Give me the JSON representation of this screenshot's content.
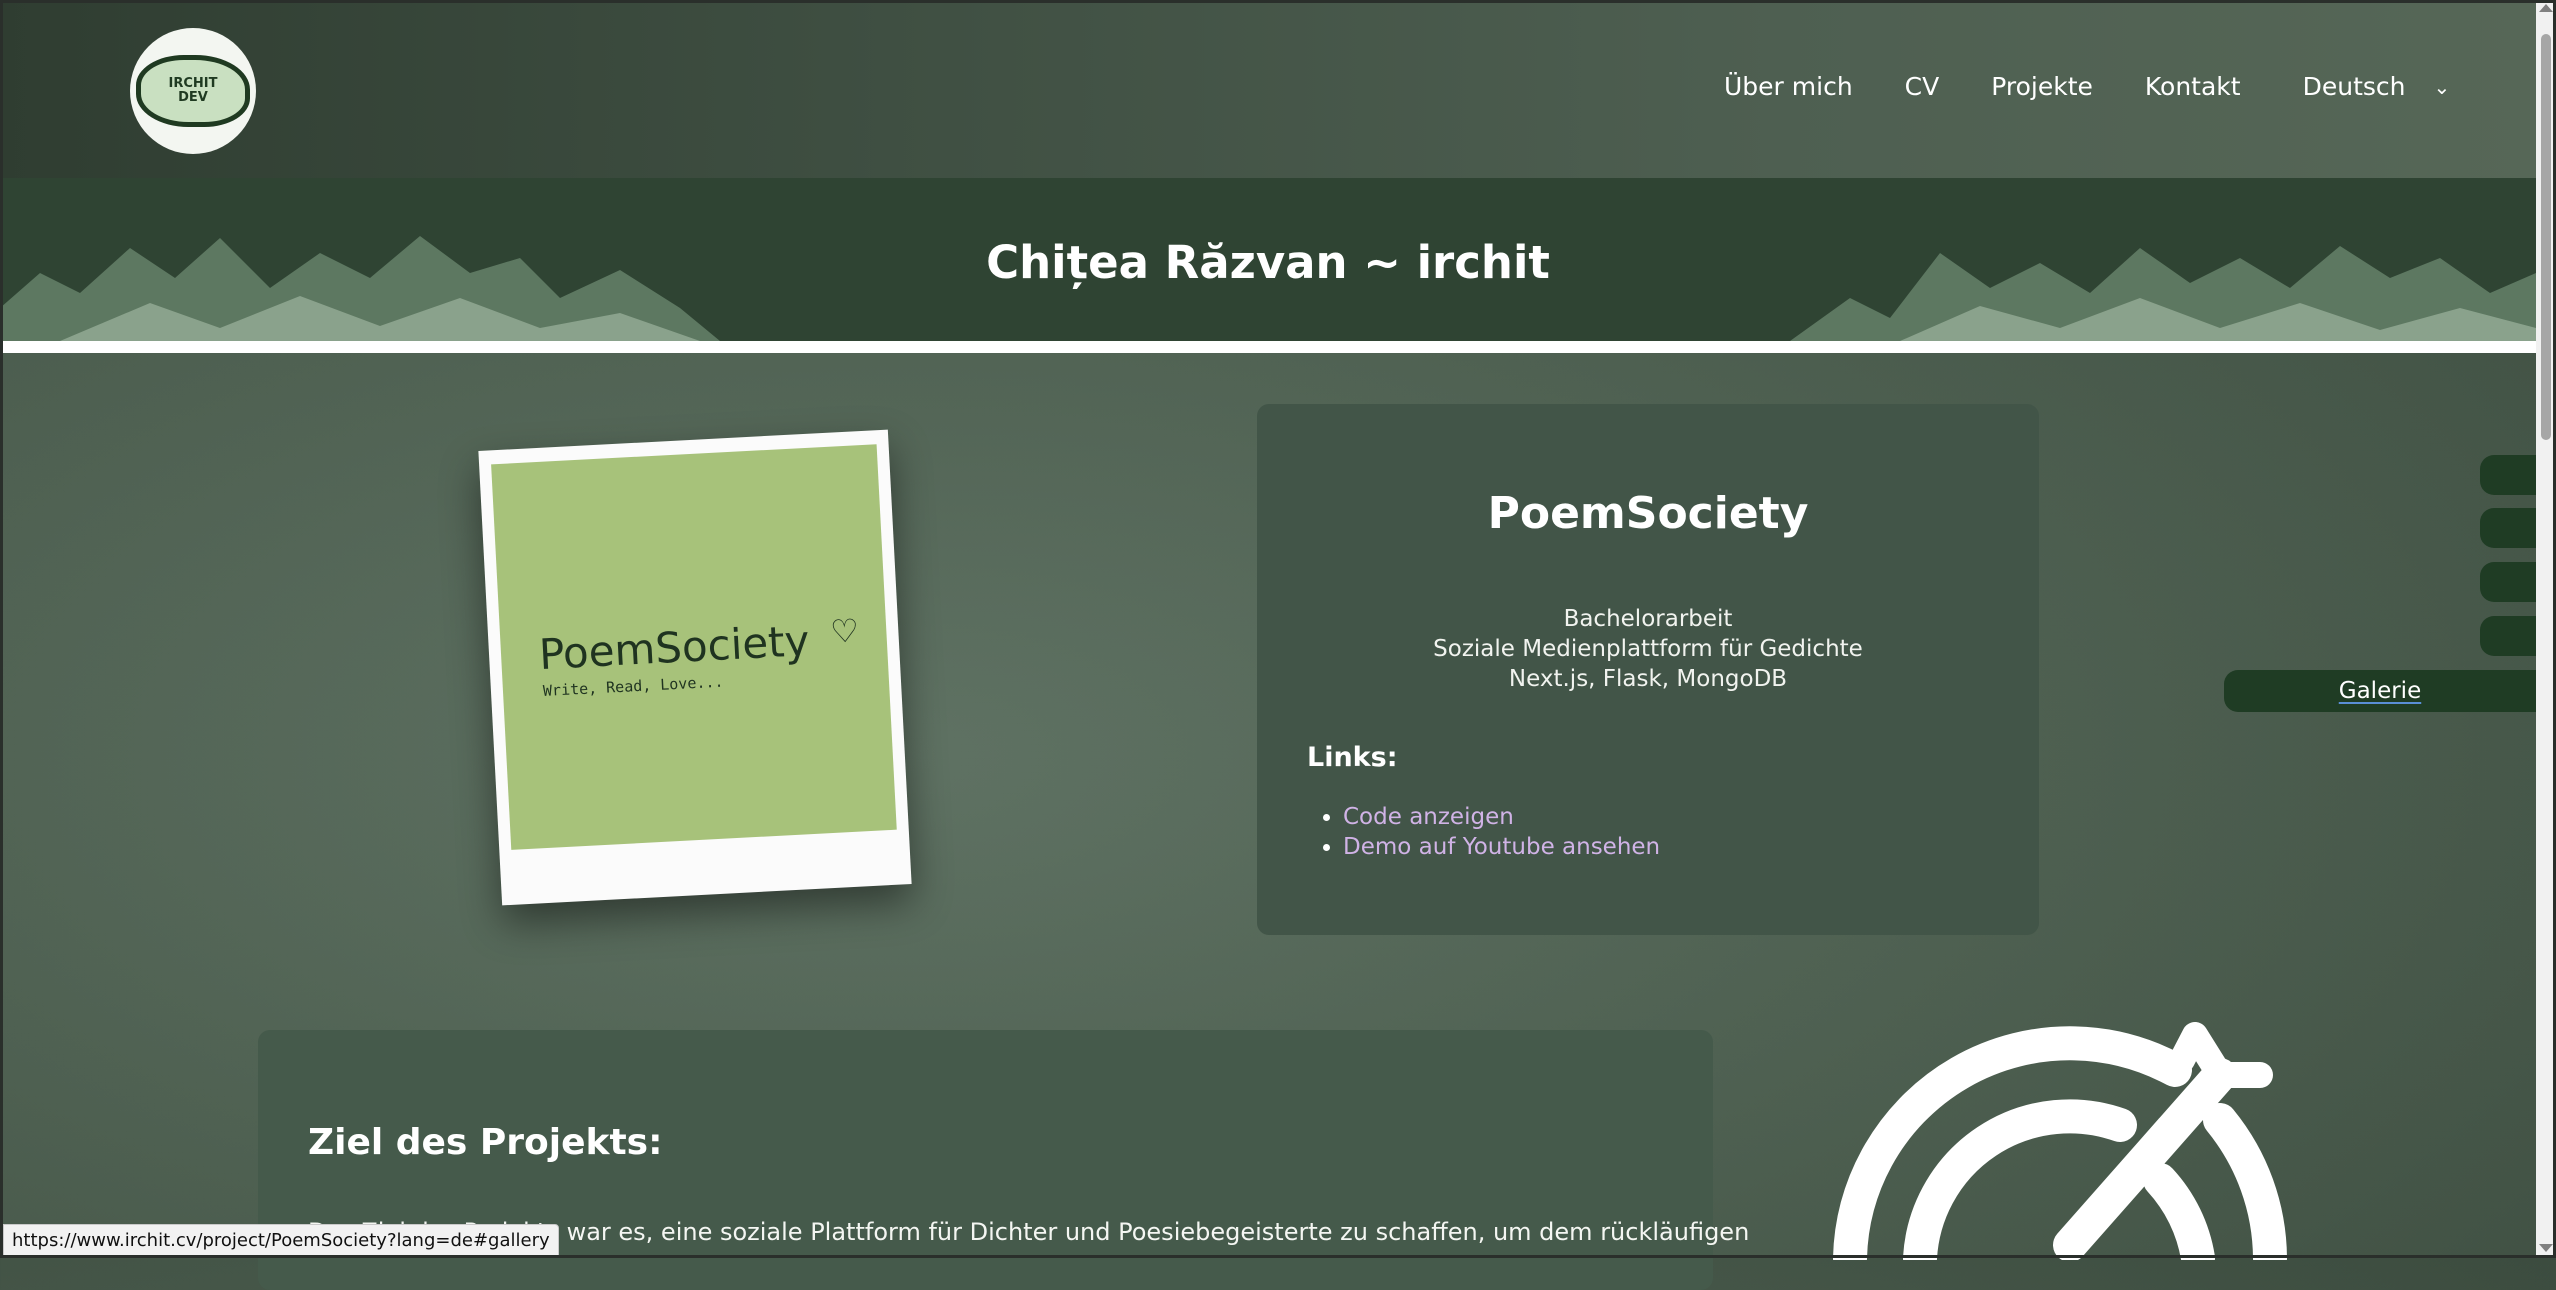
{
  "logo": {
    "line1": "IRCHIT",
    "line2": "DEV"
  },
  "nav": {
    "items": [
      {
        "label": "Über mich"
      },
      {
        "label": "CV"
      },
      {
        "label": "Projekte"
      },
      {
        "label": "Kontakt"
      }
    ],
    "language": "Deutsch"
  },
  "hero": {
    "title": "Chițea Răzvan ~ irchit"
  },
  "project_image": {
    "brand": "PoemSociety",
    "tagline": "Write, Read, Love..."
  },
  "project": {
    "title": "PoemSociety",
    "lines": [
      "Bachelorarbeit",
      "Soziale Medienplattform für Gedichte",
      "Next.js, Flask, MongoDB"
    ],
    "links_heading": "Links:",
    "links": [
      "Code anzeigen",
      "Demo auf Youtube ansehen"
    ]
  },
  "side": {
    "gallery_label": "Galerie"
  },
  "goal": {
    "heading": "Ziel des Projekts:",
    "text": "Das Ziel des Projekts war es, eine soziale Plattform für Dichter und Poesiebegeisterte zu schaffen, um dem rückläufigen"
  },
  "status_bar": {
    "url": "https://www.irchit.cv/project/PoemSociety?lang=de#gallery"
  },
  "colors": {
    "accent": "#1f3c24",
    "link": "#d0b3e6",
    "hero_bg": "#2f4433"
  }
}
